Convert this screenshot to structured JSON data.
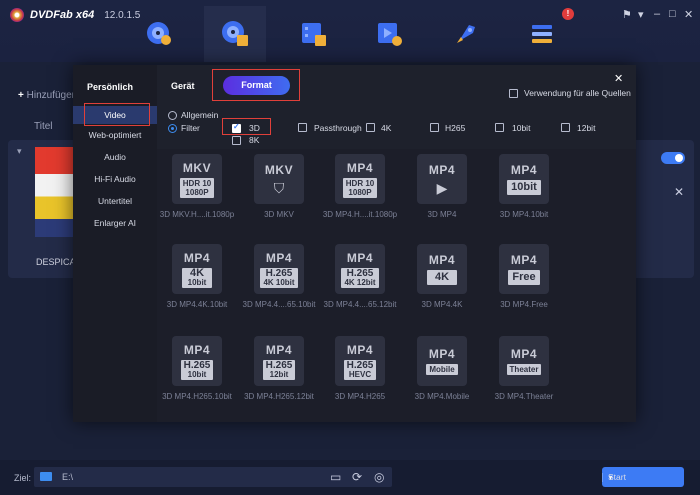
{
  "app": {
    "name": "DVDFab x64",
    "version": "12.0.1.5",
    "badge": "!"
  },
  "nav": [
    "copy-icon",
    "ripper-icon",
    "video-converter-icon",
    "creator-icon",
    "utility-icon",
    "task-queue-icon"
  ],
  "window_controls": {
    "pin": "⚑",
    "menu": "▾",
    "minimize": "–",
    "maximize": "□",
    "close": "✕"
  },
  "background": {
    "add_source": "Hinzufügen",
    "title_header": "Titel",
    "item_name": "DESPICA",
    "poster_text": "me"
  },
  "modal": {
    "sidebar": {
      "heading": "Persönlich",
      "items": [
        "Video",
        "Web-optimiert",
        "Audio",
        "Hi-Fi Audio",
        "Untertitel",
        "Enlarger AI"
      ]
    },
    "tabs": {
      "device": "Gerät",
      "format": "Format"
    },
    "apply_all": "Verwendung für alle Quellen",
    "radios": {
      "general": "Allgemein",
      "filter": "Filter"
    },
    "filters": [
      "3D",
      "Passthrough",
      "4K",
      "H265",
      "10bit",
      "12bit",
      "8K"
    ],
    "formats": [
      {
        "ext": "MKV",
        "sub": "HDR 10\n1080P",
        "name": "3D MKV.H....it.1080p"
      },
      {
        "ext": "MKV",
        "sub": "",
        "name": "3D MKV"
      },
      {
        "ext": "MP4",
        "sub": "HDR 10\n1080P",
        "name": "3D MP4.H....it.1080p"
      },
      {
        "ext": "MP4",
        "sub": "",
        "name": "3D MP4"
      },
      {
        "ext": "MP4",
        "sub": "10bit",
        "name": "3D MP4.10bit"
      },
      {
        "ext": "MP4",
        "sub": "4K\n10bit",
        "name": "3D MP4.4K.10bit"
      },
      {
        "ext": "MP4",
        "sub": "H.265\n4K 10bit",
        "name": "3D MP4.4....65.10bit"
      },
      {
        "ext": "MP4",
        "sub": "H.265\n4K 12bit",
        "name": "3D MP4.4....65.12bit"
      },
      {
        "ext": "MP4",
        "sub": "4K",
        "name": "3D MP4.4K"
      },
      {
        "ext": "MP4",
        "sub": "Free",
        "name": "3D MP4.Free"
      },
      {
        "ext": "MP4",
        "sub": "H.265\n10bit",
        "name": "3D MP4.H265.10bit"
      },
      {
        "ext": "MP4",
        "sub": "H.265\n12bit",
        "name": "3D MP4.H265.12bit"
      },
      {
        "ext": "MP4",
        "sub": "H.265\nHEVC",
        "name": "3D MP4.H265"
      },
      {
        "ext": "MP4",
        "sub": "Mobile",
        "name": "3D MP4.Mobile"
      },
      {
        "ext": "MP4",
        "sub": "Theater",
        "name": "3D MP4.Theater"
      }
    ]
  },
  "bottom": {
    "target_label": "Ziel:",
    "path": "E:\\",
    "start": "Start"
  }
}
